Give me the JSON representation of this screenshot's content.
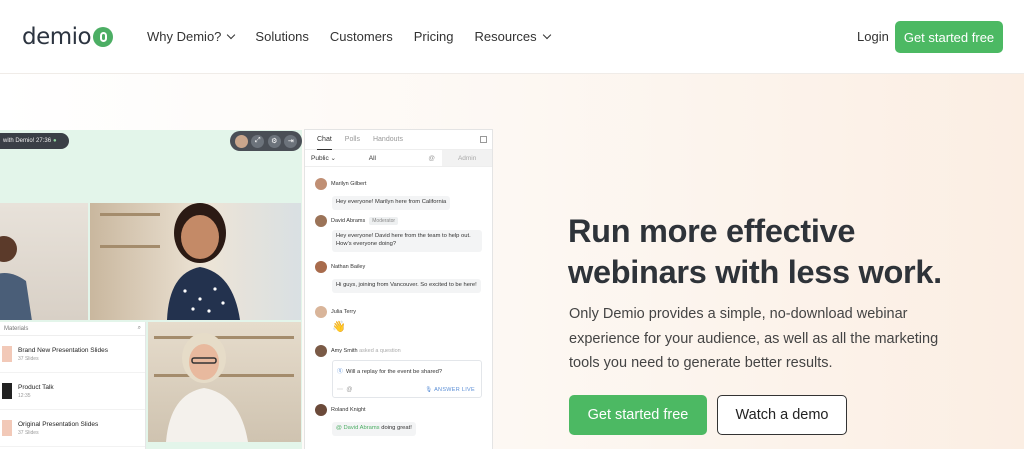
{
  "header": {
    "logo_text": "demio",
    "nav": [
      {
        "label": "Why Demio?",
        "dropdown": true
      },
      {
        "label": "Solutions",
        "dropdown": false
      },
      {
        "label": "Customers",
        "dropdown": false
      },
      {
        "label": "Pricing",
        "dropdown": false
      },
      {
        "label": "Resources",
        "dropdown": true
      }
    ],
    "login": "Login",
    "cta": "Get started free"
  },
  "colors": {
    "brand_green": "#4cb963",
    "hero_bg_warm": "#fbeee3",
    "text_dark": "#2e3339"
  },
  "mockup": {
    "session_pill": "with Demio!",
    "session_time": "27:36",
    "materials": {
      "header": "Materials",
      "items": [
        {
          "title": "Brand New Presentation Slides",
          "sub": "37 Slides"
        },
        {
          "title": "Product Talk",
          "sub": "12:35"
        },
        {
          "title": "Original Presentation Slides",
          "sub": "37 Slides"
        }
      ]
    },
    "chat": {
      "tabs": [
        "Chat",
        "Polls",
        "Handouts"
      ],
      "filter_public": "Public",
      "filter_all": "All",
      "filter_admin": "Admin",
      "messages": [
        {
          "name": "Marilyn Gilbert",
          "text": "Hey everyone! Marilyn here from California"
        },
        {
          "name": "David Abrams",
          "role": "Moderator",
          "text": "Hey everyone! David here from the team to help out. How's everyone doing?"
        },
        {
          "name": "Nathan Bailey",
          "text": "Hi guys, joining from Vancouver. So excited to be here!"
        },
        {
          "name": "Julia Terry",
          "text": "👋"
        },
        {
          "name": "Amy Smith",
          "note": "asked a question",
          "question": "Will a replay for the event be shared?",
          "answer_label": "ANSWER LIVE"
        },
        {
          "name": "Roland Knight",
          "mention": "@ David Abrams",
          "text": "doing great!"
        }
      ]
    }
  },
  "hero": {
    "headline_line1": "Run more effective",
    "headline_line2": "webinars with less work.",
    "subline": "Only Demio provides a simple, no-download webinar experience for your audience, as well as all the marketing tools you need to generate better results.",
    "cta_primary": "Get started free",
    "cta_secondary": "Watch a demo"
  }
}
